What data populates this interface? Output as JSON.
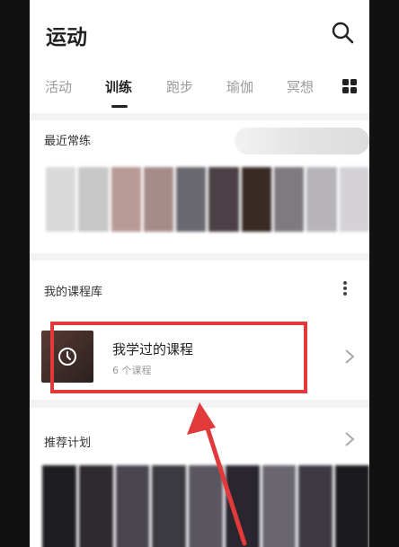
{
  "header": {
    "title": "运动"
  },
  "tabs": [
    {
      "label": "活动",
      "active": false
    },
    {
      "label": "训练",
      "active": true
    },
    {
      "label": "跑步",
      "active": false
    },
    {
      "label": "瑜伽",
      "active": false
    },
    {
      "label": "冥想",
      "active": false
    }
  ],
  "recent": {
    "title": "最近常练"
  },
  "library": {
    "title": "我的课程库",
    "item": {
      "name": "我学过的课程",
      "count": "6 个课程"
    }
  },
  "plan": {
    "title": "推荐计划"
  },
  "colors": {
    "accent": "#222222",
    "highlight": "#e23a3a",
    "muted": "#9a9a9a"
  },
  "icons": {
    "search": "search-icon",
    "grid": "grid-icon",
    "more": "more-vertical-icon",
    "clock": "clock-icon",
    "chevron": "chevron-right-icon"
  }
}
